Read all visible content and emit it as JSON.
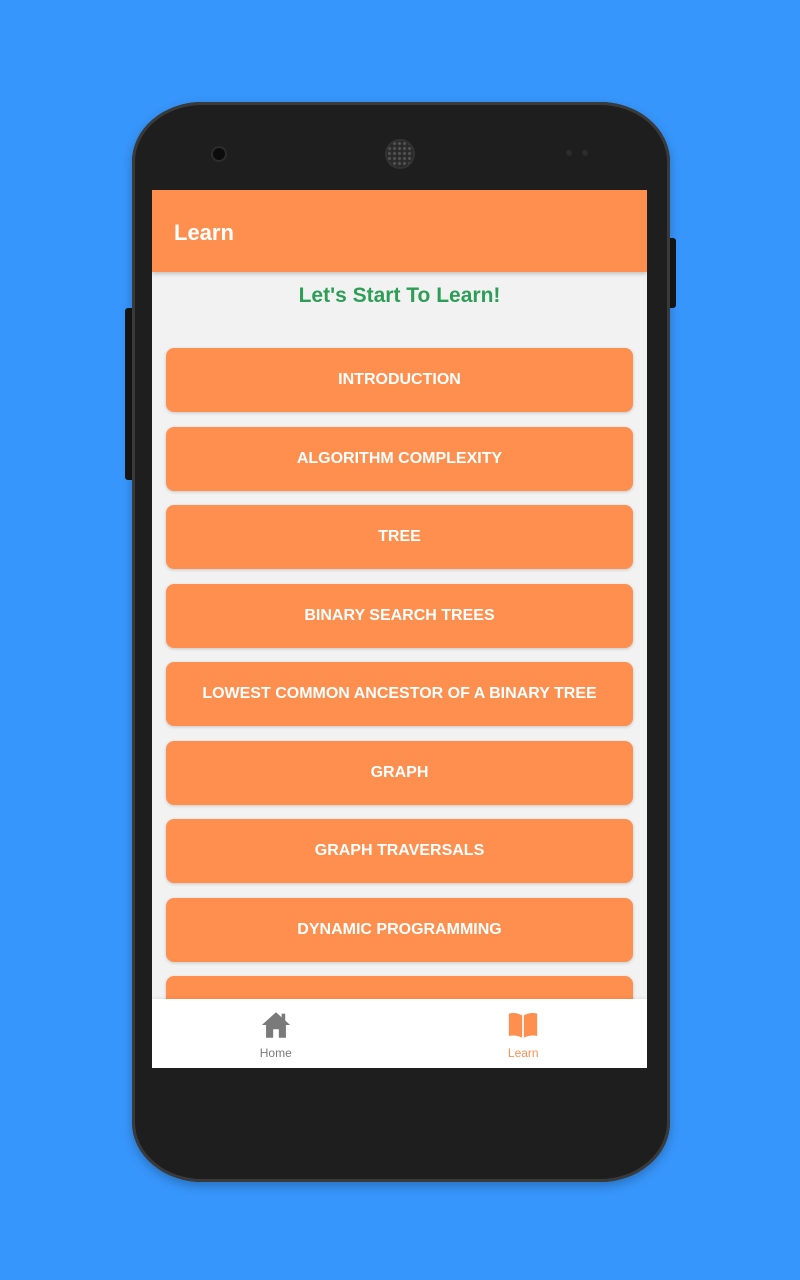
{
  "app_bar": {
    "title": "Learn"
  },
  "main": {
    "heading": "Let's Start To Learn!",
    "topics": [
      "INTRODUCTION",
      "ALGORITHM COMPLEXITY",
      "TREE",
      "BINARY SEARCH TREES",
      "LOWEST COMMON ANCESTOR OF A BINARY TREE",
      "GRAPH",
      "GRAPH TRAVERSALS",
      "DYNAMIC PROGRAMMING",
      ""
    ]
  },
  "bottom_nav": {
    "items": [
      {
        "label": "Home",
        "icon": "home-icon",
        "active": false
      },
      {
        "label": "Learn",
        "icon": "book-icon",
        "active": true
      }
    ]
  },
  "colors": {
    "background": "#3796fb",
    "accent": "#ff8f4e",
    "heading": "#2e9e57",
    "inactive": "#7a7a7a"
  }
}
